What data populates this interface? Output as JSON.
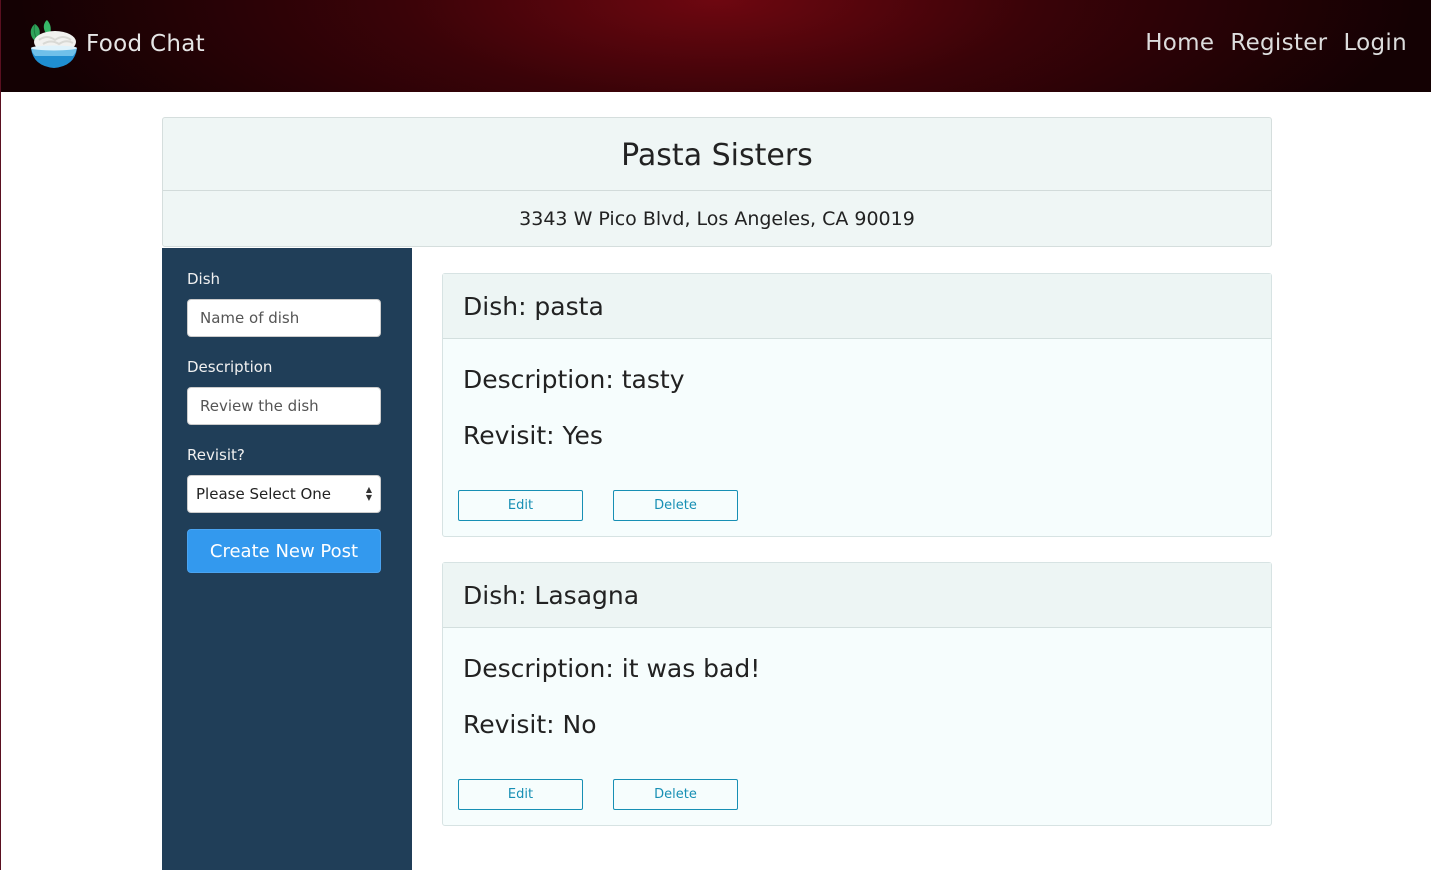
{
  "nav": {
    "brand": "Food Chat",
    "links": [
      "Home",
      "Register",
      "Login"
    ]
  },
  "restaurant": {
    "name": "Pasta Sisters",
    "address": "3343 W Pico Blvd, Los Angeles, CA 90019"
  },
  "form": {
    "dish_label": "Dish",
    "dish_placeholder": "Name of dish",
    "description_label": "Description",
    "description_placeholder": "Review the dish",
    "revisit_label": "Revisit?",
    "revisit_selected": "Please Select One",
    "create_button": "Create New Post"
  },
  "posts": [
    {
      "dish": "Dish: pasta",
      "description": "Description: tasty",
      "revisit": "Revisit: Yes",
      "edit_label": "Edit",
      "delete_label": "Delete"
    },
    {
      "dish": "Dish: Lasagna",
      "description": "Description: it was bad!",
      "revisit": "Revisit: No",
      "edit_label": "Edit",
      "delete_label": "Delete"
    }
  ],
  "colors": {
    "navbar": "#3a0308",
    "sidebar": "#203e58",
    "primary_button": "#3399ee",
    "outline_button": "#178fb4"
  }
}
